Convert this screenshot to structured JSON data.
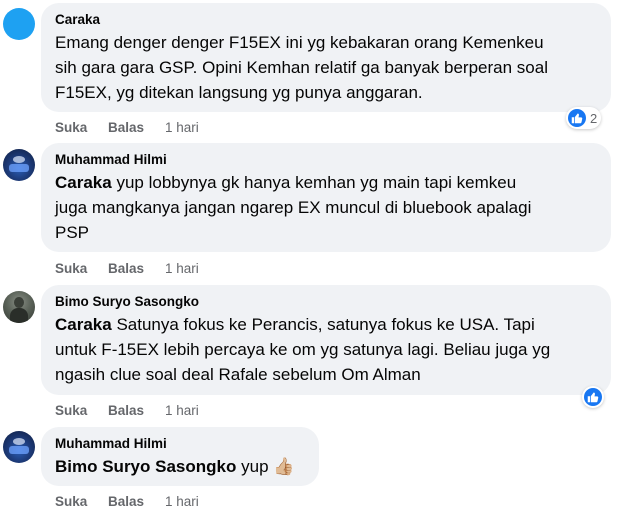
{
  "comments": [
    {
      "author": "Caraka",
      "mention": "",
      "lines": [
        "Emang denger denger F15EX ini yg kebakaran orang Kemenkeu",
        "sih gara gara GSP. Opini Kemhan relatif ga banyak berperan soal",
        "F15EX, yg ditekan langsung yg punya anggaran."
      ],
      "like_label": "Suka",
      "reply_label": "Balas",
      "time": "1 hari",
      "reaction_count": "2",
      "reaction_icon": "like-icon"
    },
    {
      "author": "Muhammad Hilmi",
      "mention": "Caraka",
      "lines": [
        "yup lobbynya gk hanya kemhan yg main tapi kemkeu",
        "juga mangkanya jangan ngarep EX muncul di bluebook apalagi",
        "PSP"
      ],
      "like_label": "Suka",
      "reply_label": "Balas",
      "time": "1 hari"
    },
    {
      "author": "Bimo Suryo Sasongko",
      "mention": "Caraka",
      "lines": [
        "Satunya fokus ke Perancis, satunya fokus ke USA. Tapi",
        "untuk F-15EX lebih percaya ke om yg satunya lagi. Beliau juga yg",
        "ngasih clue soal deal Rafale sebelum Om Alman"
      ],
      "like_label": "Suka",
      "reply_label": "Balas",
      "time": "1 hari",
      "reaction_icon": "like-icon"
    },
    {
      "author": "Muhammad Hilmi",
      "mention": "Bimo Suryo Sasongko",
      "lines": [
        "yup 👍🏼"
      ],
      "like_label": "Suka",
      "reply_label": "Balas",
      "time": "1 hari"
    }
  ],
  "colors": {
    "bubble": "#f0f2f5",
    "text": "#050505",
    "meta": "#65676b",
    "like_blue": "#1877f2",
    "avatar_blue": "#1ea1f2"
  }
}
